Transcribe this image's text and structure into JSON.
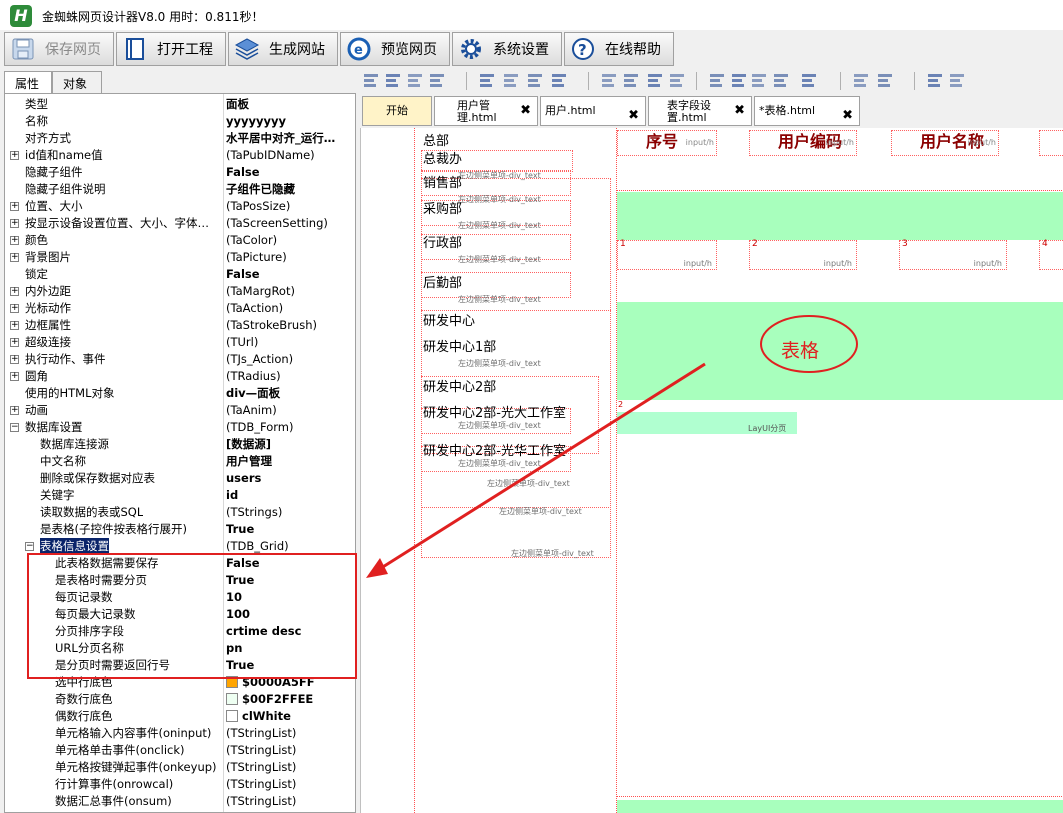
{
  "app": {
    "logo_letter": "H",
    "title": "金蜘蛛网页设计器V8.0 用时：0.811秒！"
  },
  "toolbar": {
    "buttons": [
      {
        "label": "保存网页",
        "icon": "save-icon"
      },
      {
        "label": "打开工程",
        "icon": "open-book-icon"
      },
      {
        "label": "生成网站",
        "icon": "layers-icon"
      },
      {
        "label": "预览网页",
        "icon": "ie-browser-icon"
      },
      {
        "label": "系统设置",
        "icon": "gear-icon"
      },
      {
        "label": "在线帮助",
        "icon": "help-icon"
      }
    ]
  },
  "left_tabs": [
    "属性",
    "对象"
  ],
  "properties": [
    {
      "name": "类型",
      "value": "面板",
      "bold": true,
      "expand": "",
      "indent": 0
    },
    {
      "name": "名称",
      "value": "yyyyyyyy",
      "bold": true,
      "expand": "",
      "indent": 0
    },
    {
      "name": "对齐方式",
      "value": "水平居中对齐_运行…",
      "bold": true,
      "expand": "",
      "indent": 0
    },
    {
      "name": "id值和name值",
      "value": "(TaPubIDName)",
      "bold": false,
      "expand": "+",
      "indent": 0
    },
    {
      "name": "隐藏子组件",
      "value": "False",
      "bold": true,
      "expand": "",
      "indent": 0
    },
    {
      "name": "隐藏子组件说明",
      "value": "子组件已隐藏",
      "bold": true,
      "expand": "",
      "indent": 0
    },
    {
      "name": "位置、大小",
      "value": "(TaPosSize)",
      "bold": false,
      "expand": "+",
      "indent": 0
    },
    {
      "name": "按显示设备设置位置、大小、字体…",
      "value": "(TaScreenSetting)",
      "bold": false,
      "expand": "+",
      "indent": 0
    },
    {
      "name": "颜色",
      "value": "(TaColor)",
      "bold": false,
      "expand": "+",
      "indent": 0
    },
    {
      "name": "背景图片",
      "value": "(TaPicture)",
      "bold": false,
      "expand": "+",
      "indent": 0
    },
    {
      "name": "锁定",
      "value": "False",
      "bold": true,
      "expand": "",
      "indent": 0
    },
    {
      "name": "内外边距",
      "value": "(TaMargRot)",
      "bold": false,
      "expand": "+",
      "indent": 0
    },
    {
      "name": "光标动作",
      "value": "(TaAction)",
      "bold": false,
      "expand": "+",
      "indent": 0
    },
    {
      "name": "边框属性",
      "value": "(TaStrokeBrush)",
      "bold": false,
      "expand": "+",
      "indent": 0
    },
    {
      "name": "超级连接",
      "value": "(TUrl)",
      "bold": false,
      "expand": "+",
      "indent": 0
    },
    {
      "name": "执行动作、事件",
      "value": "(TJs_Action)",
      "bold": false,
      "expand": "+",
      "indent": 0
    },
    {
      "name": "圆角",
      "value": "(TRadius)",
      "bold": false,
      "expand": "+",
      "indent": 0
    },
    {
      "name": "使用的HTML对象",
      "value": "div—面板",
      "bold": true,
      "expand": "",
      "indent": 0
    },
    {
      "name": "动画",
      "value": "(TaAnim)",
      "bold": false,
      "expand": "+",
      "indent": 0
    },
    {
      "name": "数据库设置",
      "value": "(TDB_Form)",
      "bold": false,
      "expand": "-",
      "indent": 0
    },
    {
      "name": "数据库连接源",
      "value": "[数据源]",
      "bold": true,
      "expand": "",
      "indent": 1
    },
    {
      "name": "中文名称",
      "value": "用户管理",
      "bold": true,
      "expand": "",
      "indent": 1
    },
    {
      "name": "删除或保存数据对应表",
      "value": "users",
      "bold": true,
      "expand": "",
      "indent": 1
    },
    {
      "name": "关键字",
      "value": "id",
      "bold": true,
      "expand": "",
      "indent": 1
    },
    {
      "name": "读取数据的表或SQL",
      "value": "(TStrings)",
      "bold": false,
      "expand": "",
      "indent": 1
    },
    {
      "name": "是表格(子控件按表格行展开)",
      "value": "True",
      "bold": true,
      "expand": "",
      "indent": 1
    },
    {
      "name": "表格信息设置",
      "value": "(TDB_Grid)",
      "bold": false,
      "expand": "-",
      "indent": 1,
      "selected": true
    },
    {
      "name": "此表格数据需要保存",
      "value": "False",
      "bold": true,
      "expand": "",
      "indent": 2
    },
    {
      "name": "是表格时需要分页",
      "value": "True",
      "bold": true,
      "expand": "",
      "indent": 2
    },
    {
      "name": "每页记录数",
      "value": "10",
      "bold": true,
      "expand": "",
      "indent": 2
    },
    {
      "name": "每页最大记录数",
      "value": "100",
      "bold": true,
      "expand": "",
      "indent": 2
    },
    {
      "name": "分页排序字段",
      "value": "crtime desc",
      "bold": true,
      "expand": "",
      "indent": 2
    },
    {
      "name": "URL分页名称",
      "value": "pn",
      "bold": true,
      "expand": "",
      "indent": 2
    },
    {
      "name": "是分页时需要返回行号",
      "value": "True",
      "bold": true,
      "expand": "",
      "indent": 2
    },
    {
      "name": "选中行底色",
      "value": "$0000A5FF",
      "bold": true,
      "expand": "",
      "indent": 2,
      "swatch": "#ffa500"
    },
    {
      "name": "奇数行底色",
      "value": "$00F2FFEE",
      "bold": true,
      "expand": "",
      "indent": 2,
      "swatch": "#eefff2"
    },
    {
      "name": "偶数行底色",
      "value": "clWhite",
      "bold": true,
      "expand": "",
      "indent": 2,
      "swatch": "#ffffff"
    },
    {
      "name": "单元格输入内容事件(oninput)",
      "value": "(TStringList)",
      "bold": false,
      "expand": "",
      "indent": 2
    },
    {
      "name": "单元格单击事件(onclick)",
      "value": "(TStringList)",
      "bold": false,
      "expand": "",
      "indent": 2
    },
    {
      "name": "单元格按键弹起事件(onkeyup)",
      "value": "(TStringList)",
      "bold": false,
      "expand": "",
      "indent": 2
    },
    {
      "name": "行计算事件(onrowcal)",
      "value": "(TStringList)",
      "bold": false,
      "expand": "",
      "indent": 2
    },
    {
      "name": "数据汇总事件(onsum)",
      "value": "(TStringList)",
      "bold": false,
      "expand": "",
      "indent": 2
    }
  ],
  "doc_tabs": [
    {
      "label": "开始",
      "closable": false,
      "active": false
    },
    {
      "label": "用户管理.html",
      "closable": true,
      "active": false
    },
    {
      "label": "用户.html",
      "closable": true,
      "active": false
    },
    {
      "label": "表字段设置.html",
      "closable": true,
      "active": false
    },
    {
      "label": "*表格.html",
      "closable": true,
      "active": true
    }
  ],
  "canvas": {
    "nav_items": [
      {
        "text": "总部",
        "sub": ""
      },
      {
        "text": "总裁办",
        "sub": "左边侧菜单项-div_text"
      },
      {
        "text": "销售部",
        "sub": "左边侧菜单项-div_text"
      },
      {
        "text": "采购部",
        "sub": "左边侧菜单项-div_text"
      },
      {
        "text": "行政部",
        "sub": "左边侧菜单项-div_text"
      },
      {
        "text": "后勤部",
        "sub": "左边侧菜单项-div_text"
      },
      {
        "text": "研发中心",
        "sub": ""
      },
      {
        "text": "研发中心1部",
        "sub": "左边侧菜单项-div_text"
      },
      {
        "text": "研发中心2部",
        "sub": ""
      },
      {
        "text": "研发中心2部-光大工作室",
        "sub": "左边侧菜单项-div_text"
      },
      {
        "text": "研发中心2部-光华工作室",
        "sub": "左边侧菜单项-div_text"
      }
    ],
    "nav_footer_labels": [
      "左边侧菜单项-div_text",
      "左边侧菜单项-div_text",
      "左边侧菜单项-div_text"
    ],
    "table_headers": [
      "序号",
      "用户编码",
      "用户名称"
    ],
    "header_suffix": "input/h",
    "cell_numbers": [
      "1",
      "2",
      "3",
      "4"
    ],
    "cell_suffix": "input/h",
    "pager_label": "LayUI分页",
    "row2_marker": "2",
    "annotation": "表格"
  },
  "colors": {
    "green": "#a8ffbd",
    "annotation_red": "#e02020",
    "selected_row": "#0a246a"
  }
}
